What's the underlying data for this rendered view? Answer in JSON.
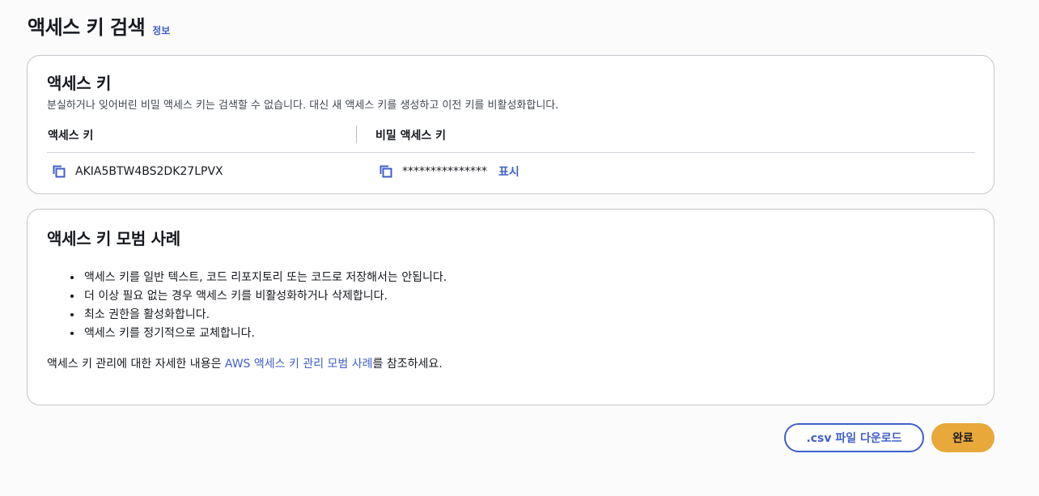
{
  "header": {
    "title": "액세스 키 검색",
    "info_label": "정보"
  },
  "keys_panel": {
    "title": "액세스 키",
    "description": "분실하거나 잊어버린 비밀 액세스 키는 검색할 수 없습니다. 대신 새 액세스 키를 생성하고 이전 키를 비활성화합니다.",
    "columns": [
      "액세스 키",
      "비밀 액세스 키"
    ],
    "access_key_id": "AKIA5BTW4BS2DK27LPVX",
    "secret_masked": "***************",
    "show_label": "표시"
  },
  "best_practices": {
    "title": "액세스 키 모범 사례",
    "items": [
      "액세스 키를 일반 텍스트, 코드 리포지토리 또는 코드로 저장해서는 안됩니다.",
      "더 이상 필요 없는 경우 액세스 키를 비활성화하거나 삭제합니다.",
      "최소 권한을 활성화합니다.",
      "액세스 키를 정기적으로 교체합니다."
    ],
    "ref_prefix": "액세스 키 관리에 대한 자세한 내용은 ",
    "ref_link": "AWS 액세스 키 관리 모범 사례",
    "ref_suffix": "를 참조하세요."
  },
  "actions": {
    "download_label": ".csv 파일 다운로드",
    "done_label": "완료"
  },
  "colors": {
    "link": "#3f5fc9",
    "primary_button": "#e8a83a",
    "border": "#c6c6cd"
  },
  "icons": {
    "copy": "copy-icon"
  }
}
